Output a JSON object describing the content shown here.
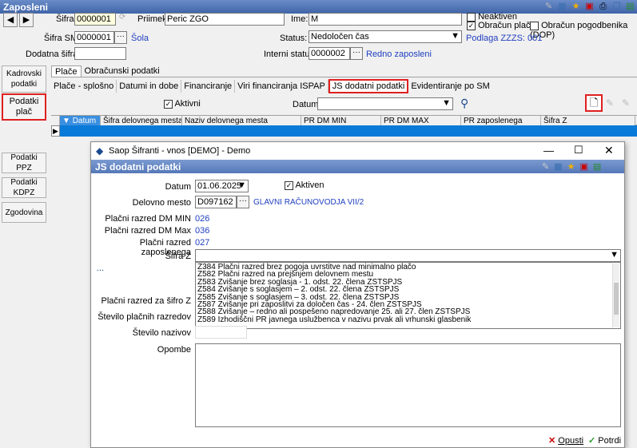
{
  "window": {
    "title": "Zaposleni"
  },
  "header": {
    "sifra_label": "Šifra",
    "sifra_value": "0000001",
    "priimek_label": "Priimek:",
    "priimek_value": "Peric ZGO",
    "ime_label": "Ime:",
    "ime_value": "M",
    "neaktiven_label": "Neaktiven",
    "obracun_plac_label": "Obračun plač",
    "obracun_pogodbenika_label": "Obračun pogodbenika (DOP)",
    "sifra_sm_label": "Šifra SM",
    "sifra_sm_value": "0000001",
    "sola_link": "Šola",
    "status_label": "Status:",
    "status_value": "Nedoločen čas",
    "podlaga_text": "Podlaga ZZZS: 001",
    "dodatna_sifra_label": "Dodatna šifra:",
    "dodatna_sifra_value": "",
    "interni_statusi_label": "Interni statusi:",
    "interni_statusi_value": "0000002",
    "interni_statusi_link": "Redno zaposleni"
  },
  "sidebar": {
    "items": [
      {
        "label": "Kadrovski podatki"
      },
      {
        "label": "Podatki plač"
      },
      {
        "label": "Podatki PPZ"
      },
      {
        "label": "Podatki KDPZ"
      },
      {
        "label": "Zgodovina"
      }
    ]
  },
  "main_tabs": [
    "Plače",
    "Obračunski podatki"
  ],
  "sub_tabs": [
    "Plače - splošno",
    "Datumi in dobe",
    "Financiranje",
    "Viri financiranja ISPAP",
    "JS dodatni podatki",
    "Evidentiranje po SM"
  ],
  "filter": {
    "aktivni_label": "Aktivni",
    "datum_label": "Datum",
    "datum_value": ""
  },
  "grid": {
    "columns": [
      "Datum",
      "Šifra delovnega mesta",
      "Naziv delovnega mesta",
      "PR DM MIN",
      "PR DM MAX",
      "PR zaposlenega",
      "Šifra Z"
    ]
  },
  "dialog": {
    "title": "Saop Šifranti - vnos [DEMO] - Demo",
    "section": "JS dodatni podatki",
    "datum_label": "Datum",
    "datum_value": "01.06.2025",
    "aktiven_label": "Aktiven",
    "delovno_mesto_label": "Delovno mesto",
    "delovno_mesto_value": "D097162",
    "delovno_mesto_name": "GLAVNI RAČUNOVODJA VII/2",
    "pr_dm_min_label": "Plačni razred DM MIN",
    "pr_dm_min_value": "026",
    "pr_dm_max_label": "Plačni razred DM Max",
    "pr_dm_max_value": "036",
    "pr_zap_label": "Plačni razred zaposlenega",
    "pr_zap_value": "027",
    "sifra_z_label": "Šifra Z",
    "ellipsis": "...",
    "pr_za_sifro_label": "Plačni razred za šifro Z",
    "stevilo_razredov_label": "Število plačnih razredov",
    "stevilo_nazivov_label": "Število nazivov",
    "opombe_label": "Opombe",
    "dropdown_items": [
      "Z384 Plačni razred brez pogoja uvrstitve nad minimalno plačo",
      "Z582 Plačni razred na prejšnjem delovnem mestu",
      "Z583 Zvišanje brez soglasja - 1. odst. 22. člena ZSTSPJS",
      "Z584 Zvišanje s soglasjem – 2. odst. 22. člena ZSTSPJS",
      "Z585 Zvišanje s soglasjem – 3. odst. 22. člena ZSTSPJS",
      "Z587 Zvišanje pri zaposlitvi za določen čas - 24. člen ZSTSPJS",
      "Z588 Zvišanje – redno ali pospešeno napredovanje 25. ali 27. člen ZSTSPJS",
      "Z589 Izhodiščni PR javnega uslužbenca v nazivu prvak ali vrhunski glasbenik"
    ],
    "opusti_label": "Opusti",
    "potrdi_label": "Potrdi"
  }
}
